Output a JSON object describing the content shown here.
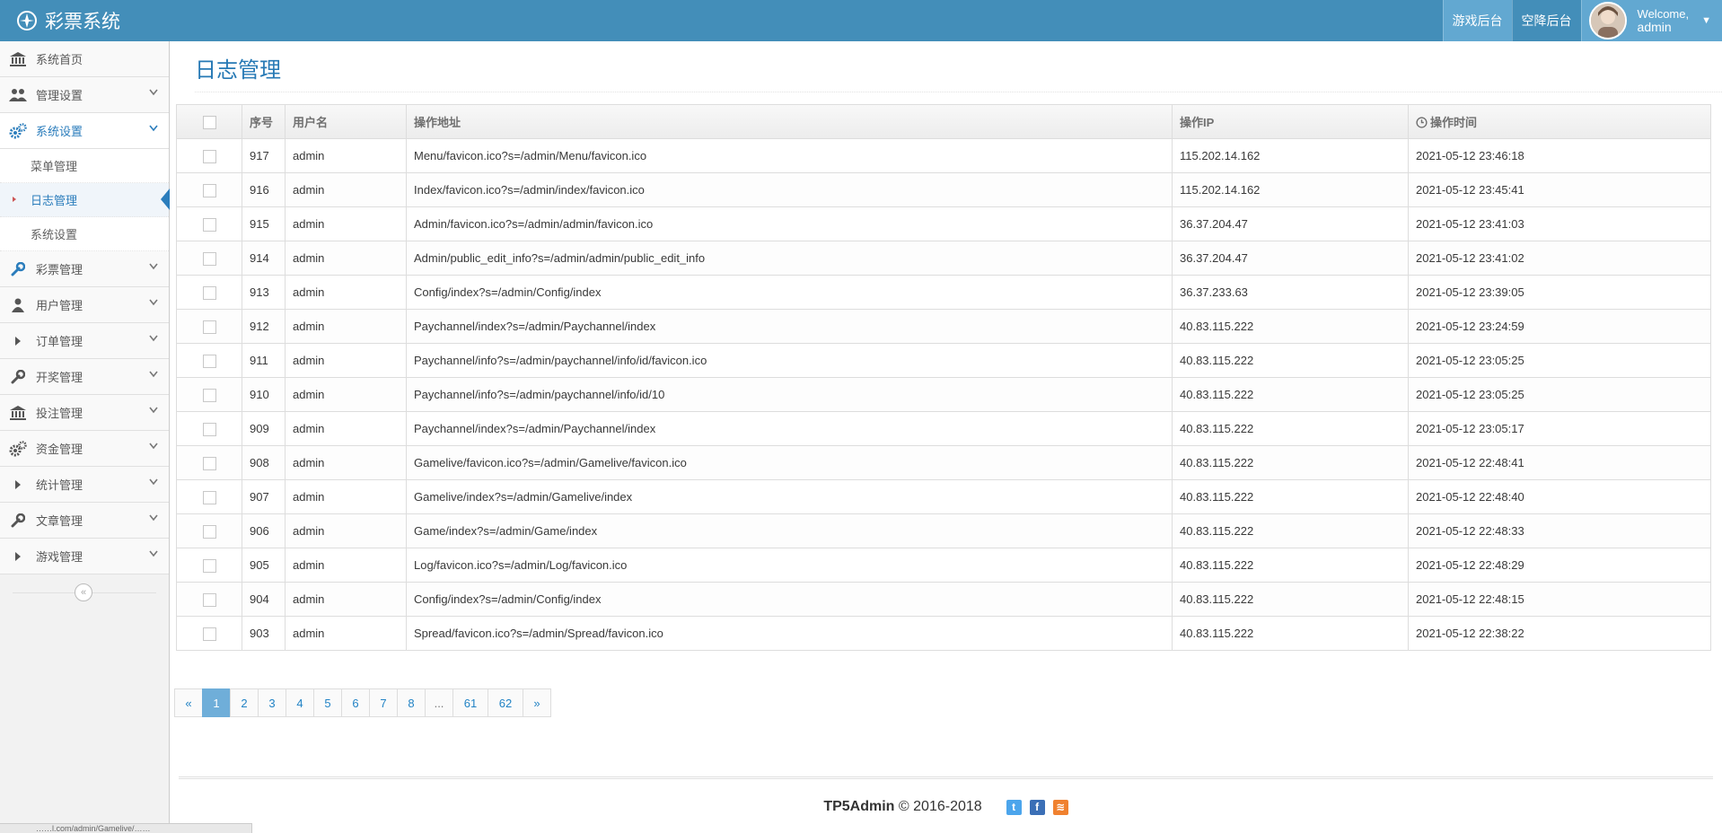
{
  "app": {
    "title": "彩票系统"
  },
  "navbar": {
    "links": [
      "游戏后台",
      "空降后台"
    ],
    "welcome": "Welcome,",
    "username": "admin"
  },
  "sidebar": {
    "items": [
      {
        "label": "系统首页",
        "icon": "bank-icon"
      },
      {
        "label": "管理设置",
        "icon": "users-icon"
      },
      {
        "label": "系统设置",
        "icon": "cogs-icon"
      },
      {
        "label": "彩票管理",
        "icon": "wrench-icon"
      },
      {
        "label": "用户管理",
        "icon": "user-icon"
      },
      {
        "label": "订单管理",
        "icon": "caret-right-icon"
      },
      {
        "label": "开奖管理",
        "icon": "wrench-icon"
      },
      {
        "label": "投注管理",
        "icon": "bank-icon"
      },
      {
        "label": "资金管理",
        "icon": "cogs-icon"
      },
      {
        "label": "统计管理",
        "icon": "caret-right-icon"
      },
      {
        "label": "文章管理",
        "icon": "wrench-icon"
      },
      {
        "label": "游戏管理",
        "icon": "caret-right-icon"
      }
    ],
    "submenu": [
      "菜单管理",
      "日志管理",
      "系统设置"
    ],
    "collapse_symbol": "«"
  },
  "page": {
    "title": "日志管理"
  },
  "table": {
    "headers": {
      "no": "序号",
      "user": "用户名",
      "addr": "操作地址",
      "ip": "操作IP",
      "time": "操作时间"
    },
    "rows": [
      [
        "917",
        "admin",
        "Menu/favicon.ico?s=/admin/Menu/favicon.ico",
        "115.202.14.162",
        "2021-05-12 23:46:18"
      ],
      [
        "916",
        "admin",
        "Index/favicon.ico?s=/admin/index/favicon.ico",
        "115.202.14.162",
        "2021-05-12 23:45:41"
      ],
      [
        "915",
        "admin",
        "Admin/favicon.ico?s=/admin/admin/favicon.ico",
        "36.37.204.47",
        "2021-05-12 23:41:03"
      ],
      [
        "914",
        "admin",
        "Admin/public_edit_info?s=/admin/admin/public_edit_info",
        "36.37.204.47",
        "2021-05-12 23:41:02"
      ],
      [
        "913",
        "admin",
        "Config/index?s=/admin/Config/index",
        "36.37.233.63",
        "2021-05-12 23:39:05"
      ],
      [
        "912",
        "admin",
        "Paychannel/index?s=/admin/Paychannel/index",
        "40.83.115.222",
        "2021-05-12 23:24:59"
      ],
      [
        "911",
        "admin",
        "Paychannel/info?s=/admin/paychannel/info/id/favicon.ico",
        "40.83.115.222",
        "2021-05-12 23:05:25"
      ],
      [
        "910",
        "admin",
        "Paychannel/info?s=/admin/paychannel/info/id/10",
        "40.83.115.222",
        "2021-05-12 23:05:25"
      ],
      [
        "909",
        "admin",
        "Paychannel/index?s=/admin/Paychannel/index",
        "40.83.115.222",
        "2021-05-12 23:05:17"
      ],
      [
        "908",
        "admin",
        "Gamelive/favicon.ico?s=/admin/Gamelive/favicon.ico",
        "40.83.115.222",
        "2021-05-12 22:48:41"
      ],
      [
        "907",
        "admin",
        "Gamelive/index?s=/admin/Gamelive/index",
        "40.83.115.222",
        "2021-05-12 22:48:40"
      ],
      [
        "906",
        "admin",
        "Game/index?s=/admin/Game/index",
        "40.83.115.222",
        "2021-05-12 22:48:33"
      ],
      [
        "905",
        "admin",
        "Log/favicon.ico?s=/admin/Log/favicon.ico",
        "40.83.115.222",
        "2021-05-12 22:48:29"
      ],
      [
        "904",
        "admin",
        "Config/index?s=/admin/Config/index",
        "40.83.115.222",
        "2021-05-12 22:48:15"
      ],
      [
        "903",
        "admin",
        "Spread/favicon.ico?s=/admin/Spread/favicon.ico",
        "40.83.115.222",
        "2021-05-12 22:38:22"
      ]
    ]
  },
  "pagination": [
    "«",
    "1",
    "2",
    "3",
    "4",
    "5",
    "6",
    "7",
    "8",
    "...",
    "61",
    "62",
    "»"
  ],
  "pagination_active": "1",
  "footer": {
    "brand": "TP5Admin",
    "copyright": "© 2016-2018"
  },
  "statusbar": {
    "url": "……l.com/admin/Gamelive/……"
  },
  "colors": {
    "navbar": "#438eb9",
    "accent": "#2679b5",
    "active_page": "#6faed9"
  }
}
